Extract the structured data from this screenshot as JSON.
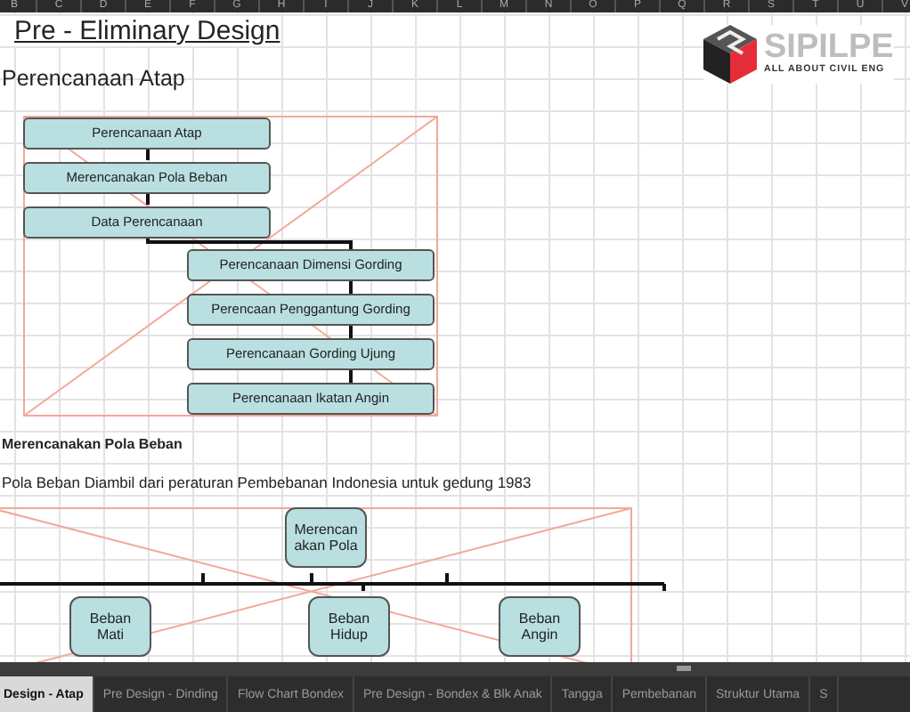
{
  "column_headers": [
    "B",
    "C",
    "D",
    "E",
    "F",
    "G",
    "H",
    "I",
    "J",
    "K",
    "L",
    "M",
    "N",
    "O",
    "P",
    "Q",
    "R",
    "S",
    "T",
    "U",
    "V"
  ],
  "title": "Pre - Eliminary Design",
  "logo": {
    "name": "SIPILPE",
    "tagline": "ALL ABOUT CIVIL ENG"
  },
  "section_1": {
    "heading": "Perencanaan Atap",
    "flowchart": {
      "left": [
        "Perencanaan Atap",
        "Merencanakan Pola Beban",
        "Data Perencanaan"
      ],
      "right": [
        "Perencanaan Dimensi Gording",
        "Perencaan Penggantung Gording",
        "Perencanaan Gording Ujung",
        "Perencanaan Ikatan Angin"
      ]
    }
  },
  "section_2": {
    "heading": "Merencanakan Pola Beban",
    "note": "Pola Beban Diambil dari peraturan Pembebanan Indonesia untuk gedung 1983",
    "diagram": {
      "top": "Merencanakan Pola",
      "branches": [
        "Beban Mati",
        "Beban Hidup",
        "Beban Angin"
      ]
    }
  },
  "sheet_tabs": [
    {
      "label": "Design - Atap",
      "selected": true
    },
    {
      "label": "Pre Design - Dinding",
      "selected": false
    },
    {
      "label": "Flow Chart Bondex",
      "selected": false
    },
    {
      "label": "Pre Design - Bondex & Blk Anak",
      "selected": false
    },
    {
      "label": "Tangga",
      "selected": false
    },
    {
      "label": "Pembebanan",
      "selected": false
    },
    {
      "label": "Struktur Utama",
      "selected": false
    },
    {
      "label": "S",
      "selected": false
    }
  ]
}
